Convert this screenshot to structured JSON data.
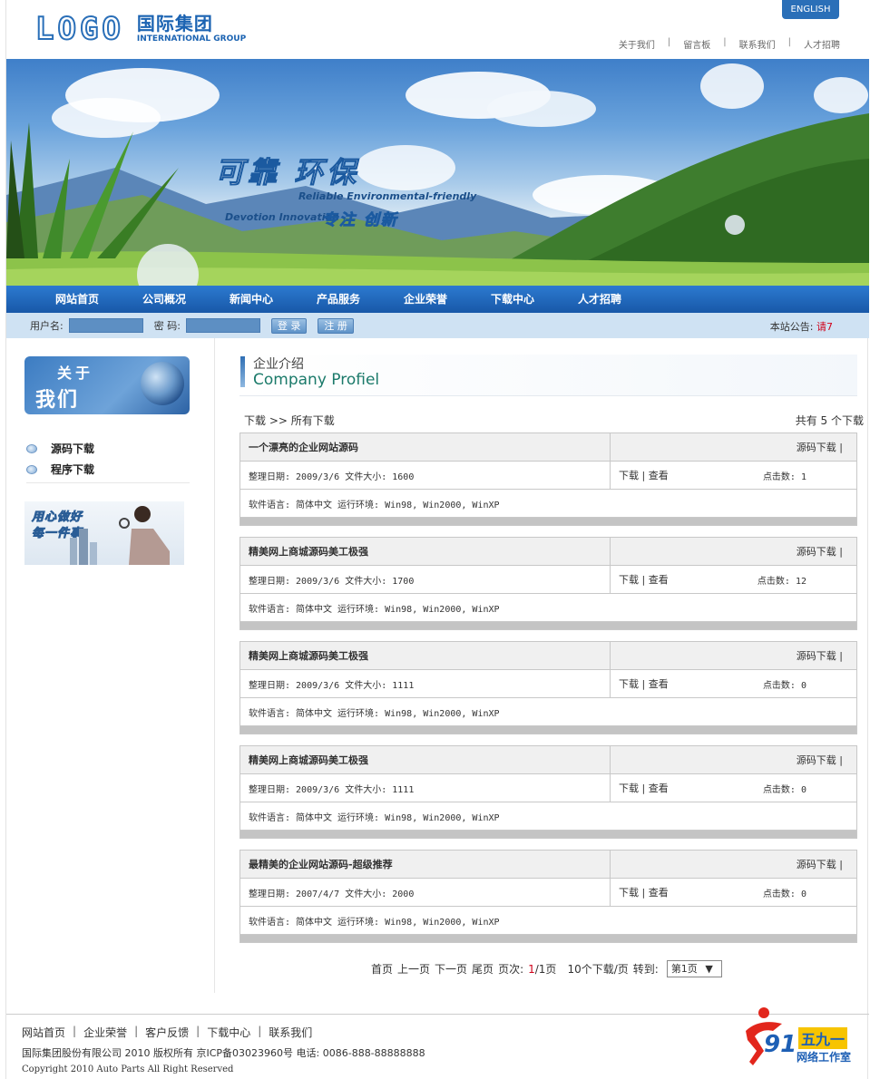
{
  "header": {
    "logo_text": "LOGO",
    "logo_cn": "国际集团",
    "logo_en": "INTERNATIONAL GROUP",
    "english_btn": "ENGLISH",
    "top_links": [
      "关于我们",
      "留言板",
      "联系我们",
      "人才招聘"
    ]
  },
  "banner": {
    "slogan_cn": "可靠 环保",
    "slogan_en": "Reliable Environmental-friendly",
    "slogan_en2": "Devotion Innovation",
    "slogan_cn2": "专注 创新"
  },
  "nav": [
    "网站首页",
    "公司概况",
    "新闻中心",
    "产品服务",
    "企业荣誉",
    "下载中心",
    "人才招聘"
  ],
  "login": {
    "user_label": "用户名:",
    "pass_label": "密 码:",
    "login_btn": "登 录",
    "register_btn": "注 册",
    "notice_label": "本站公告:",
    "notice_text": "请7"
  },
  "sidebar": {
    "about_t1": "关于",
    "about_t2": "我们",
    "items": [
      "源码下载",
      "程序下载"
    ],
    "promo_line1": "用心做好",
    "promo_line2": "每一件事"
  },
  "main": {
    "title_cn": "企业介绍",
    "title_en": "Company Profiel",
    "crumb": "下载 >> 所有下载",
    "total": "共有 5 个下载",
    "items": [
      {
        "title": "一个漂亮的企业网站源码",
        "category": "源码下载 |",
        "meta": "整理日期: 2009/3/6  文件大小: 1600",
        "actions": "下载 | 查看",
        "clicks": "点击数: 1",
        "info": "软件语言: 简体中文  运行环境: Win98, Win2000, WinXP"
      },
      {
        "title": "精美网上商城源码美工极强",
        "category": "源码下载 |",
        "meta": "整理日期: 2009/3/6  文件大小: 1700",
        "actions": "下载 | 查看",
        "clicks": "点击数: 12",
        "info": "软件语言: 简体中文  运行环境: Win98, Win2000, WinXP"
      },
      {
        "title": "精美网上商城源码美工极强",
        "category": "源码下载 |",
        "meta": "整理日期: 2009/3/6  文件大小: 1111",
        "actions": "下载 | 查看",
        "clicks": "点击数: 0",
        "info": "软件语言: 简体中文  运行环境: Win98, Win2000, WinXP"
      },
      {
        "title": "精美网上商城源码美工极强",
        "category": "源码下载 |",
        "meta": "整理日期: 2009/3/6  文件大小: 1111",
        "actions": "下载 | 查看",
        "clicks": "点击数: 0",
        "info": "软件语言: 简体中文  运行环境: Win98, Win2000, WinXP"
      },
      {
        "title": "最精美的企业网站源码-超级推荐",
        "category": "源码下载 |",
        "meta": "整理日期: 2007/4/7  文件大小: 2000",
        "actions": "下载 | 查看",
        "clicks": "点击数: 0",
        "info": "软件语言: 简体中文  运行环境: Win98, Win2000, WinXP"
      }
    ],
    "pager": {
      "first": "首页",
      "prev": "上一页",
      "next": "下一页",
      "last": "尾页",
      "page_label": "页次:",
      "current": "1",
      "total_pages": "/1页",
      "per_page": "10个下载/页",
      "goto": "转到:",
      "select": "第1页"
    }
  },
  "footer": {
    "links": [
      "网站首页",
      "企业荣誉",
      "客户反馈",
      "下载中心",
      "联系我们"
    ],
    "copyright": "国际集团股份有限公司 2010 版权所有 京ICP备03023960号 电话: 0086-888-88888888",
    "copyright_en": "Copyright 2010 Auto Parts All Right Reserved",
    "studio_num": "91",
    "studio_badge": "五九一",
    "studio_name": "网络工作室"
  }
}
